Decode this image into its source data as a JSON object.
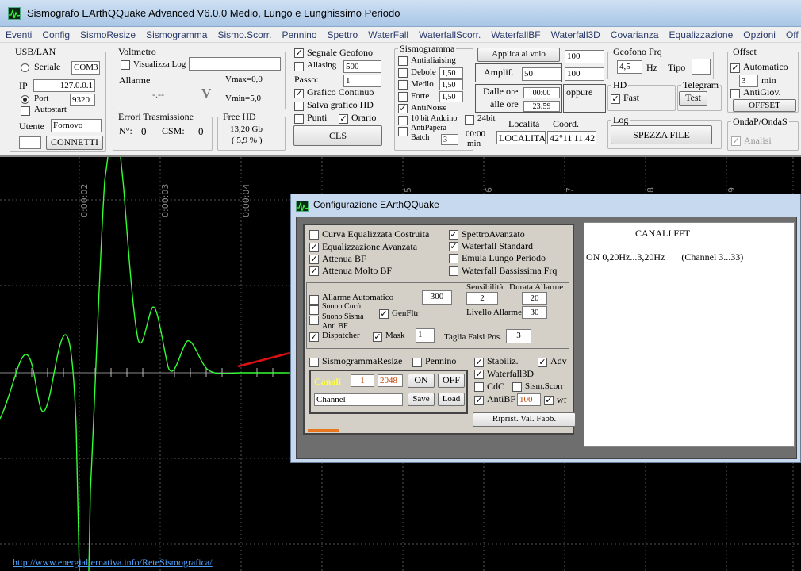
{
  "app": {
    "title": "Sismografo  EArthQQuake Advanced V6.0.0  Medio, Lungo e Lunghissimo Periodo"
  },
  "menu": [
    "Eventi",
    "Config",
    "SismoResize",
    "Sismogramma",
    "Sismo.Scorr.",
    "Pennino",
    "Spettro",
    "WaterFall",
    "WaterfallScorr.",
    "WaterfallBF",
    "Waterfall3D",
    "Covarianza",
    "Equalizzazione",
    "Opzioni",
    "Off"
  ],
  "usb": {
    "legend": "USB/LAN",
    "seriale": "Seriale",
    "com": "COM3",
    "ip_label": "IP",
    "ip": "127.0.0.1",
    "port_label": "Port",
    "port": "9320",
    "autostart": "Autostart",
    "utente_label": "Utente",
    "utente": "Fornovo",
    "connetti": "CONNETTI"
  },
  "voltmetro": {
    "legend": "Voltmetro",
    "visualizza_log": "Visualizza Log",
    "allarme": "Allarme",
    "vmax": "Vmax=0,0",
    "vmin": "Vmin=5,0",
    "dash": "-.--",
    "unit": "V"
  },
  "errori": {
    "legend": "Errori Trasmissione",
    "n_label": "N°:",
    "n": "0",
    "csm_label": "CSM:",
    "csm": "0"
  },
  "freehd": {
    "legend": "Free HD",
    "size": "13,20 Gb",
    "pct": "( 5,9 % )"
  },
  "segnale": {
    "segnale_geofono": "Segnale Geofono",
    "aliasing": "Aliasing",
    "aliasing_val": "500",
    "passo_label": "Passo:",
    "passo": "1",
    "grafico_continuo": "Grafico Continuo",
    "salva_hd": "Salva grafico HD",
    "punti": "Punti",
    "orario": "Orario",
    "cls": "CLS"
  },
  "sismogramma": {
    "legend": "Sismogramma",
    "antialiaising": "Antialiaising",
    "debole": "Debole",
    "debole_val": "1,50",
    "medio": "Medio",
    "medio_val": "1,50",
    "forte": "Forte",
    "forte_val": "1,50",
    "antinoise": "AntiNoise",
    "bit10": "10 bit Arduino",
    "bit24": "24bit",
    "antipapera": "AntiPapera",
    "batch": "Batch",
    "batch_val": "3",
    "time": "00:00",
    "min": "min"
  },
  "volo": {
    "applica": "Applica al volo",
    "applica_val": "100",
    "amplif": "Amplif.",
    "amplif_val": "50",
    "amplif_val2": "100",
    "dalle_ore": "Dalle ore",
    "dalle_val": "00:00",
    "alle_ore": "alle ore",
    "alle_val": "23:59",
    "oppure": "oppure",
    "localita_label": "Località",
    "coord_label": "Coord.",
    "localita": "LOCALITA",
    "coord": "42°11'11.42"
  },
  "geofono": {
    "legend": "Geofono Frq",
    "freq": "4,5",
    "hz": "Hz",
    "tipo": "Tipo"
  },
  "hd": {
    "legend": "HD",
    "fast": "Fast"
  },
  "telegram": {
    "legend": "Telegram",
    "test": "Test"
  },
  "log": {
    "legend": "Log",
    "spezza": "SPEZZA FILE"
  },
  "offset": {
    "legend": "Offset",
    "automatico": "Automatico",
    "min_val": "3",
    "min": "min",
    "antigiov": "AntiGiov.",
    "btn": "OFFSET"
  },
  "onda": {
    "legend": "OndaP/OndaS",
    "analisi": "Analisi"
  },
  "plot": {
    "time_labels": [
      "0:00:02",
      "0:00:03",
      "0:00:04",
      "5",
      "6",
      "7",
      "8",
      "9",
      "0"
    ],
    "trace_color": "#33ff33",
    "url": "http://www.energialternativa.info/ReteSismografica/"
  },
  "dialog": {
    "title": "Configurazione EArthQQuake",
    "checks_left": [
      {
        "label": "Curva Equalizzata Costruita",
        "checked": false
      },
      {
        "label": "Equalizzazione Avanzata",
        "checked": true
      },
      {
        "label": "Attenua BF",
        "checked": true
      },
      {
        "label": "Attenua Molto  BF",
        "checked": true
      }
    ],
    "checks_right": [
      {
        "label": "SpettroAvanzato",
        "checked": true
      },
      {
        "label": "Waterfall Standard",
        "checked": true
      },
      {
        "label": "Emula Lungo Periodo",
        "checked": false
      },
      {
        "label": "Waterfall Bassissima Frq",
        "checked": false
      }
    ],
    "allarme_automatico": "Allarme Automatico",
    "suono_cucu": "Suono Cucù",
    "suono_sisma": "Suono Sisma",
    "anti_bf": "Anti BF",
    "dispatcher": "Dispatcher",
    "genfltr": "GenFltr",
    "mask": "Mask",
    "sensibilita": "Sensibilità",
    "durata_allarme": "Durata Allarme",
    "v300": "300",
    "sens_val": "2",
    "durata_val": "20",
    "livello_allarme": "Livello Allarme",
    "livello_val": "30",
    "mask_val": "1",
    "taglia": "Taglia Falsi Pos.",
    "taglia_val": "3",
    "sismogramma_resize": "SismogrammaResize",
    "pennino": "Pennino",
    "stabiliz": "Stabiliz.",
    "adv": "Adv",
    "waterfall3d": "Waterfall3D",
    "cdc": "CdC",
    "sism_scorr": "Sism.Scorr",
    "antibf": "AntiBF",
    "antibf_val": "100",
    "wf": "wf",
    "canali": "Canali",
    "canali_from": "1",
    "canali_to": "2048",
    "on": "ON",
    "off": "OFF",
    "channel": "Channel",
    "save": "Save",
    "load": "Load",
    "ripristina": "Riprist. Val. Fabb.",
    "canali_fft": "CANALI FFT",
    "fft_line": "ON 0,20Hz...3,20Hz       (Channel 3...33)",
    "progress": 0.12
  },
  "colors": {
    "arrow": "#e01010",
    "canali_label": "#ffff40",
    "progress": "#e87820"
  }
}
